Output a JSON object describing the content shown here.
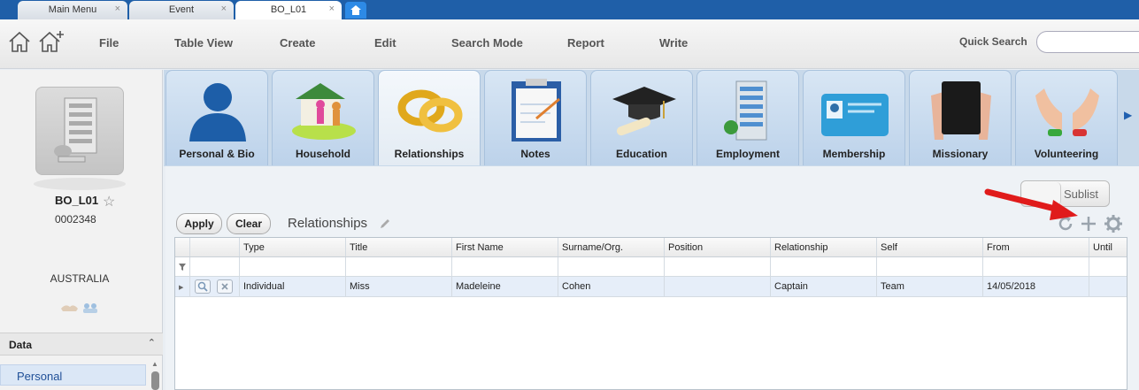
{
  "tabs": [
    {
      "label": "Main Menu",
      "close": "×"
    },
    {
      "label": "Event",
      "close": "×"
    },
    {
      "label": "BO_L01",
      "close": "×",
      "active": true
    }
  ],
  "icons": {
    "home_tab": "home-icon",
    "toolbar_home": "home-outline-icon",
    "toolbar_add_home": "add-home-icon"
  },
  "menu": [
    "File",
    "Table View",
    "Create",
    "Edit",
    "Search Mode",
    "Report",
    "Write"
  ],
  "quick_search": {
    "label": "Quick Search",
    "value": ""
  },
  "record": {
    "name": "BO_L01",
    "id": "0002348",
    "country": "AUSTRALIA"
  },
  "sidebar": {
    "header": "Data",
    "collapse": "⌃",
    "items": [
      "Personal"
    ]
  },
  "modules": [
    {
      "label": "Personal & Bio",
      "icon": "person-icon"
    },
    {
      "label": "Household",
      "icon": "household-icon"
    },
    {
      "label": "Relationships",
      "icon": "rings-icon",
      "active": true
    },
    {
      "label": "Notes",
      "icon": "clipboard-icon"
    },
    {
      "label": "Education",
      "icon": "graduation-cap-icon"
    },
    {
      "label": "Employment",
      "icon": "office-building-icon"
    },
    {
      "label": "Membership",
      "icon": "membership-card-icon"
    },
    {
      "label": "Missionary",
      "icon": "bible-icon"
    },
    {
      "label": "Volunteering",
      "icon": "hands-icon"
    }
  ],
  "sublist": {
    "label": "Sublist"
  },
  "actions": {
    "apply": "Apply",
    "clear": "Clear",
    "section_title": "Relationships"
  },
  "grid": {
    "columns": [
      "Type",
      "Title",
      "First Name",
      "Surname/Org.",
      "Position",
      "Relationship",
      "Self",
      "From",
      "Until"
    ],
    "rows": [
      [
        "Individual",
        "Miss",
        "Madeleine",
        "Cohen",
        "",
        "Captain",
        "Team",
        "14/05/2018",
        ""
      ]
    ]
  },
  "colors": {
    "tab_strip": "#1f5fa8",
    "active_module": "#e3ebf3",
    "selected_row": "#e6eef9",
    "annotation_arrow": "#e01b1b"
  }
}
